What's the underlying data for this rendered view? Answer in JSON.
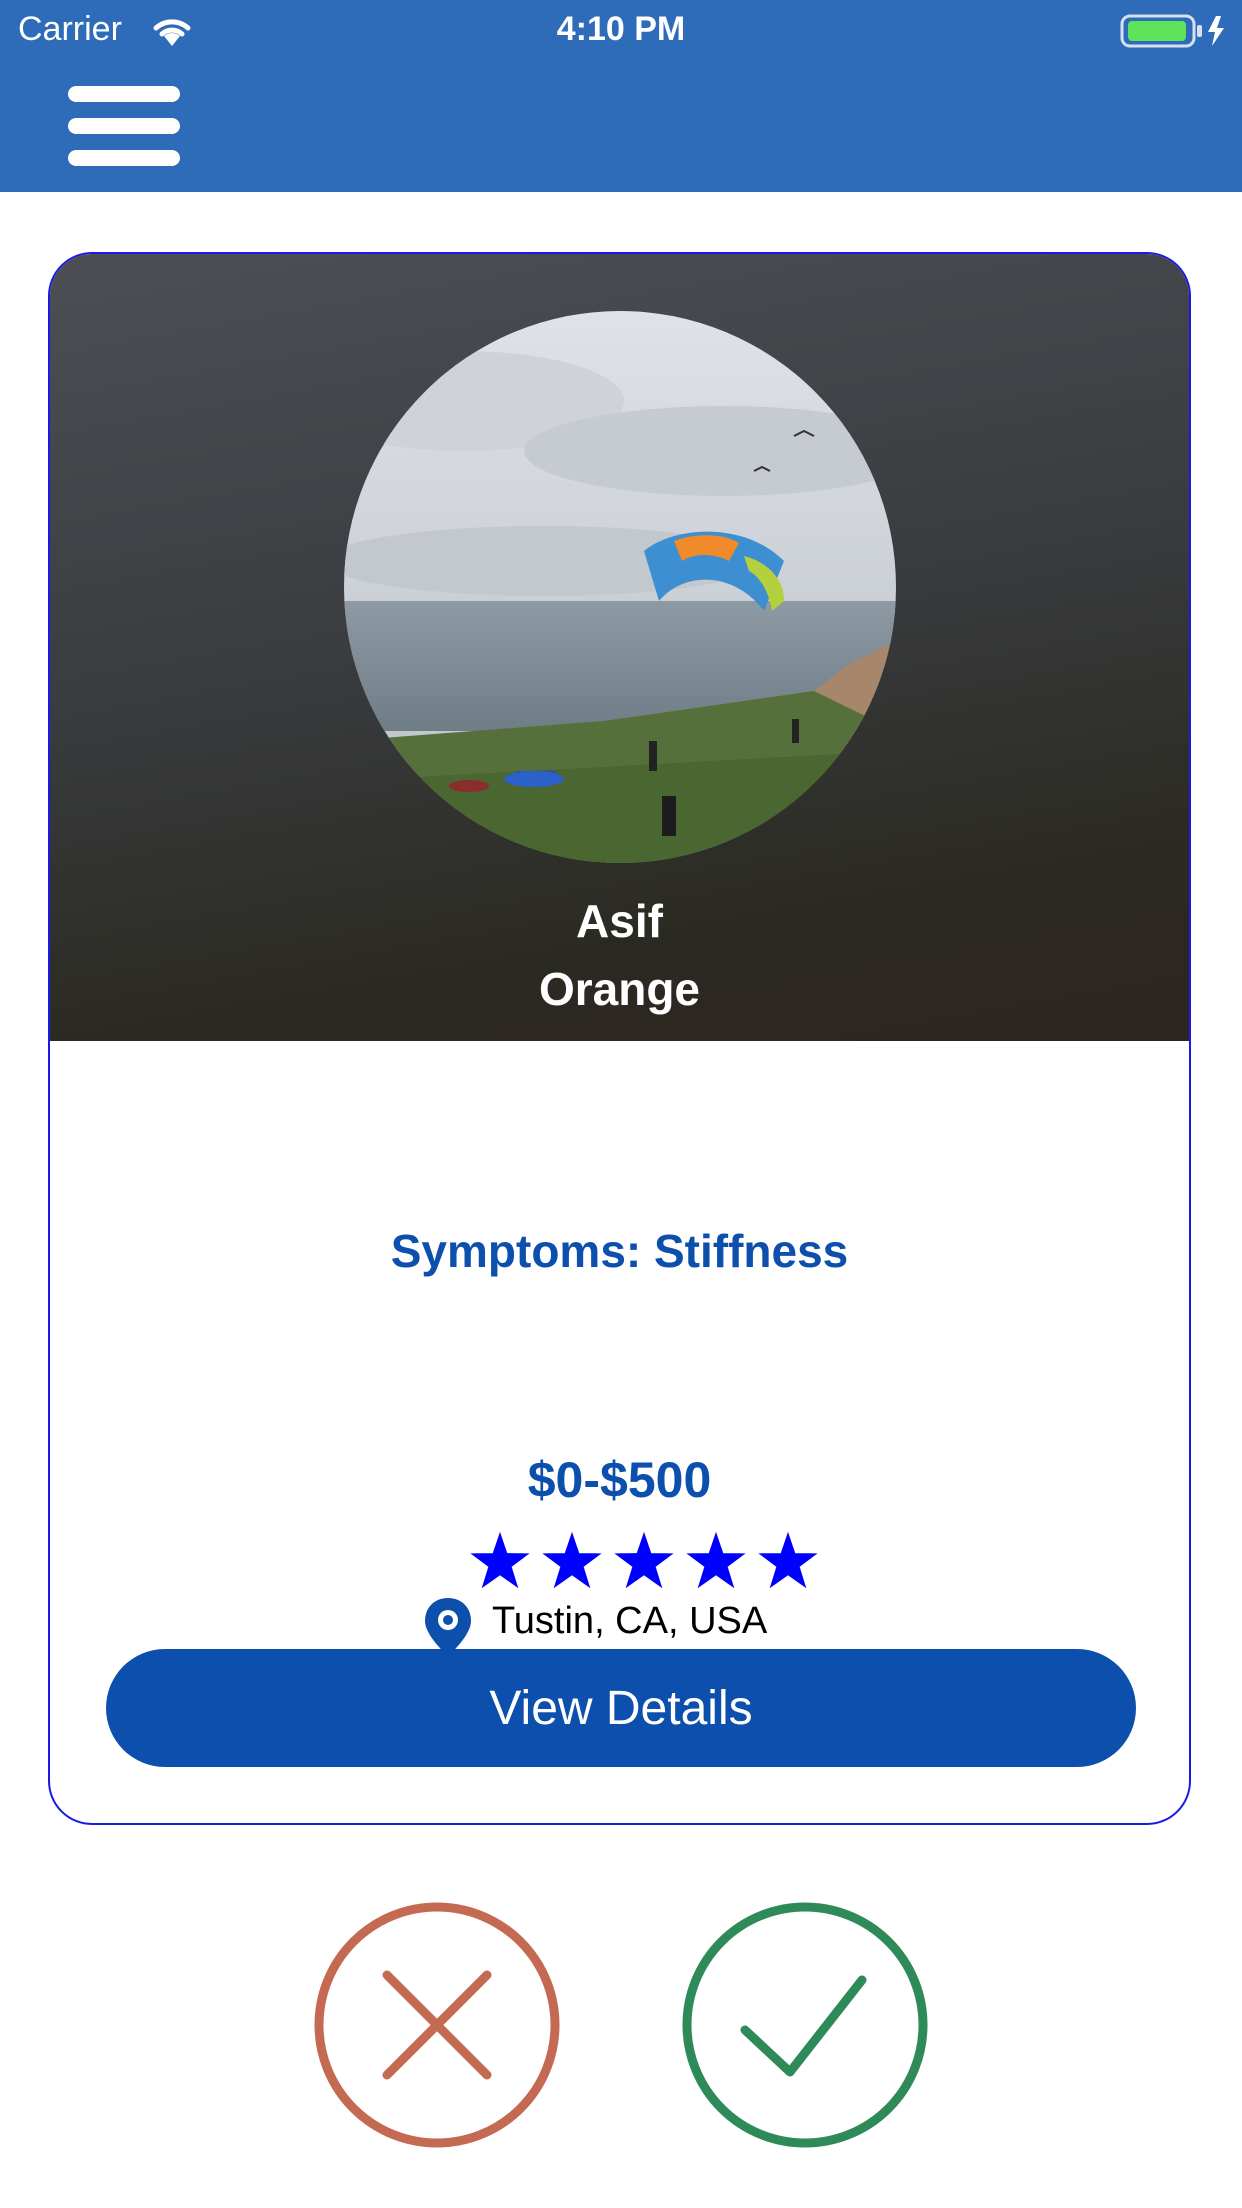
{
  "status_bar": {
    "carrier": "Carrier",
    "time": "4:10 PM",
    "wifi_icon": "wifi-icon",
    "battery_icon": "battery-charging-icon"
  },
  "nav": {
    "menu_icon": "hamburger-menu-icon"
  },
  "profile": {
    "first_name": "Asif",
    "last_name": "Orange",
    "photo_icon": "paragliding-photo"
  },
  "details": {
    "symptoms": "Symptoms: Stiffness",
    "price_range": "$0-$500",
    "rating": 5,
    "rating_max": 5,
    "location": "Tustin, CA, USA",
    "location_icon": "map-pin-icon",
    "view_details_label": "View Details"
  },
  "actions": {
    "reject_icon": "close-icon",
    "accept_icon": "checkmark-icon"
  },
  "colors": {
    "header": "#2e6bb8",
    "card_border": "#1a1ae6",
    "accent_text": "#0c4fad",
    "star": "#0000ff",
    "reject": "#c46a52",
    "accept": "#2f8a5a"
  }
}
